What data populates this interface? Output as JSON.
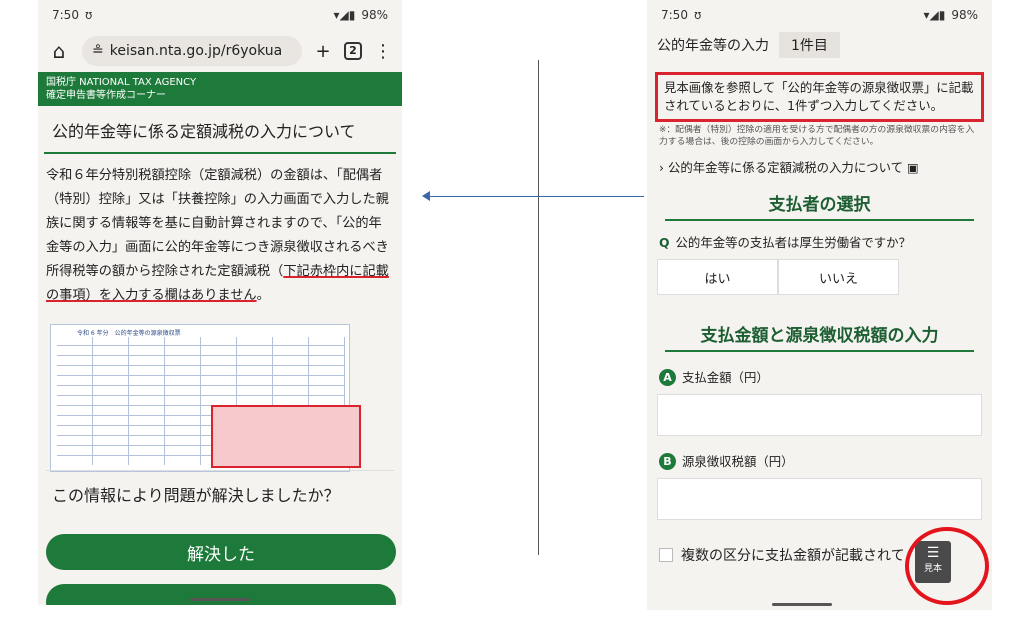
{
  "left": {
    "status": {
      "time": "7:50",
      "battery": "98%"
    },
    "url": "keisan.nta.go.jp/r6yokua",
    "tab_count": "2",
    "header": {
      "line1": "国税庁  NATIONAL TAX AGENCY",
      "line2": "確定申告書等作成コーナー"
    },
    "title": "公的年金等に係る定額減税の入力について",
    "body_plain": "令和６年分特別税額控除（定額減税）の金額は、「配偶者（特別）控除」又は「扶養控除」の入力画面で入力した親族に関する情報等を基に自動計算されますので、「公的年金等の入力」画面に公的年金等につき源泉徴収されるべき所得税等の額から控除された定額減税（",
    "body_underlined": "下記赤枠内に記載の事項）を入力する欄はありません",
    "body_end": "。",
    "sample_title": "令和 6 年分　公的年金等の源泉徴収票",
    "question": "この情報により問題が解決しましたか？",
    "resolved_button": "解決した"
  },
  "right": {
    "status": {
      "time": "7:50",
      "battery": "98%"
    },
    "heading": "公的年金等の入力",
    "count_badge": "1件目",
    "notice": "見本画像を参照して「公的年金等の源泉徴収票」に記載されているとおりに、1件ずつ入力してください。",
    "note": "※：配偶者（特別）控除の適用を受ける方で配偶者の方の源泉徴収票の内容を入力する場合は、後の控除の画面から入力してください。",
    "link": "公的年金等に係る定額減税の入力について",
    "section1": "支払者の選択",
    "q_mark": "Q",
    "question": "公的年金等の支払者は厚生労働省ですか？",
    "yes": "はい",
    "no": "いいえ",
    "section2": "支払金額と源泉徴収税額の入力",
    "field_a_badge": "A",
    "field_a": "支払金額（円）",
    "field_b_badge": "B",
    "field_b": "源泉徴収税額（円）",
    "checkbox_label": "複数の区分に支払金額が記載されて",
    "sample_button": "見本"
  }
}
